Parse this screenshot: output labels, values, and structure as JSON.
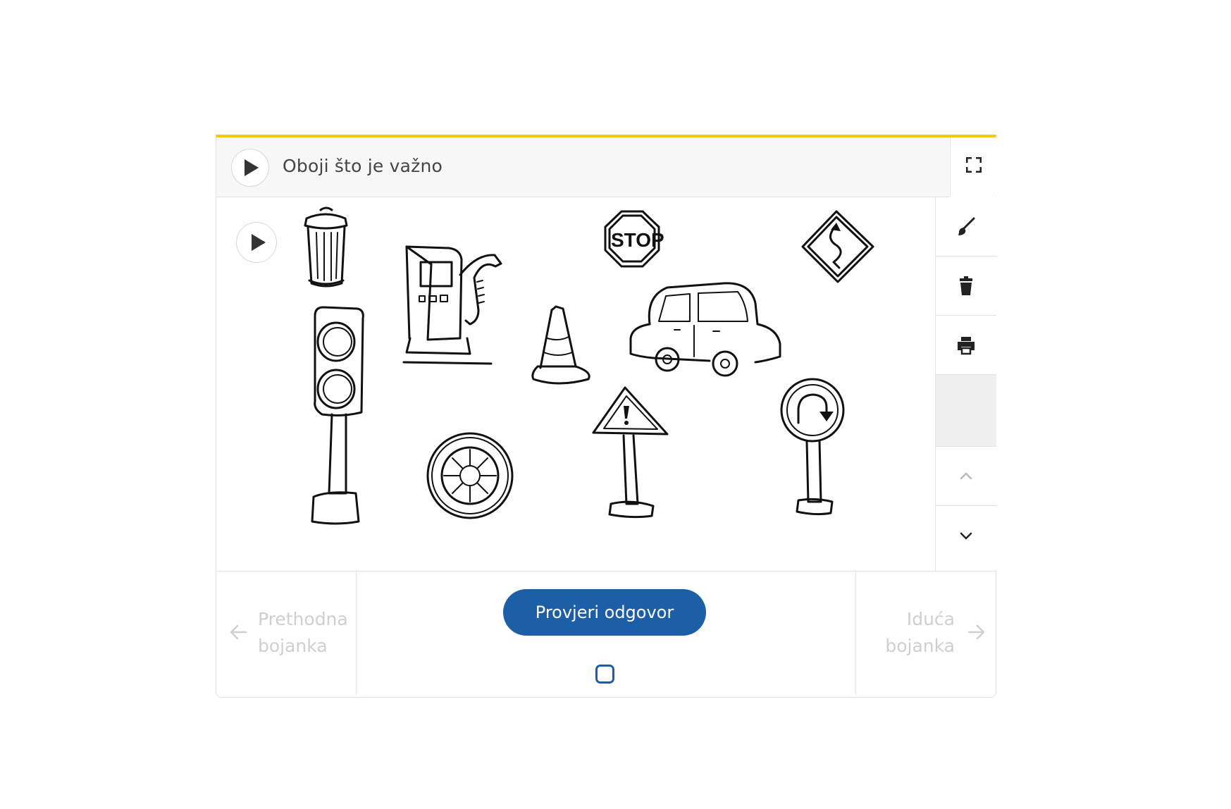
{
  "header": {
    "title": "Oboji što je važno",
    "play_icon": "play-icon",
    "fullscreen_icon": "fullscreen-icon"
  },
  "canvas": {
    "play_icon": "play-icon",
    "objects": [
      "trash-can",
      "fuel-pump",
      "stop-sign",
      "winding-road-sign",
      "traffic-light",
      "traffic-cone",
      "car",
      "wheel",
      "warning-sign",
      "u-turn-sign"
    ],
    "stop_sign_text": "STOP"
  },
  "toolbar": {
    "tools": [
      "brush-icon",
      "trash-icon",
      "print-icon"
    ],
    "scroll_up_icon": "chevron-up-icon",
    "scroll_down_icon": "chevron-down-icon"
  },
  "footer": {
    "prev_line1": "Prethodna",
    "prev_line2": "bojanka",
    "next_line1": "Iduća",
    "next_line2": "bojanka",
    "check_button": "Provjeri odgovor"
  },
  "colors": {
    "accent_top_border": "#f5c518",
    "primary_button": "#1d5fa6",
    "disabled_text": "#cfcfcf"
  }
}
